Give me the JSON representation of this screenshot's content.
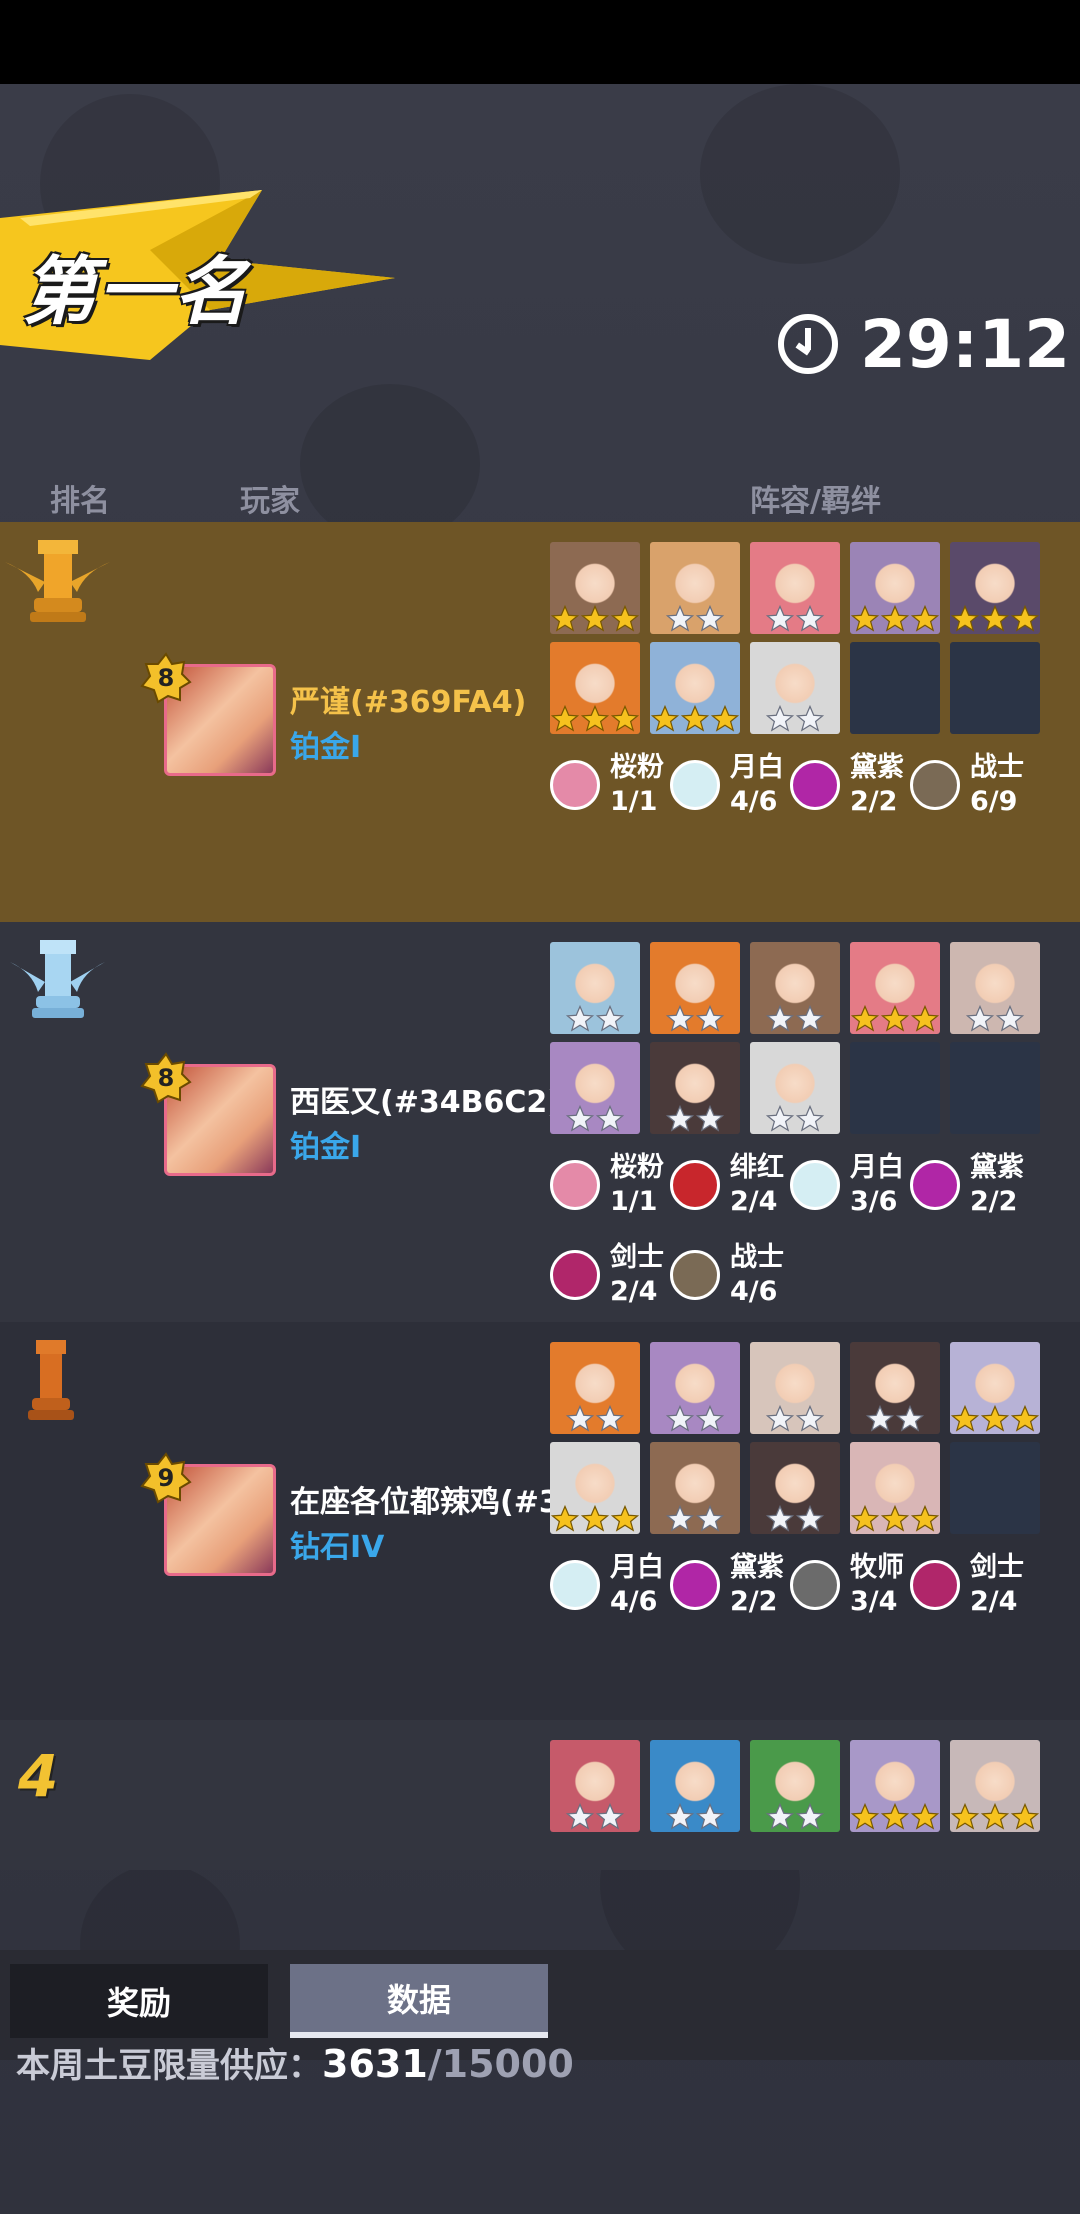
{
  "banner": {
    "title": "第一名",
    "timer": "29:12"
  },
  "columns": {
    "rank": "排名",
    "player": "玩家",
    "lineup": "阵容/羁绊"
  },
  "rows": [
    {
      "rank": 1,
      "player": {
        "level": "8",
        "name": "严谨(#369FA4)",
        "tier": "铂金I",
        "name_color": "#f5c24a"
      },
      "heroes": [
        {
          "stars": 3,
          "color": "#8d6a52"
        },
        {
          "stars": 2,
          "color": "#d9a26b"
        },
        {
          "stars": 2,
          "color": "#e47b86"
        },
        {
          "stars": 3,
          "color": "#9b84b6"
        },
        {
          "stars": 3,
          "color": "#5a4a6a"
        },
        {
          "stars": 3,
          "color": "#e37b2c"
        },
        {
          "stars": 3,
          "color": "#8fb2d8"
        },
        {
          "stars": 2,
          "color": "#d8d8d8"
        },
        {
          "stars": 0,
          "color": ""
        },
        {
          "stars": 0,
          "color": ""
        }
      ],
      "bonds": [
        {
          "name": "桜粉",
          "count": "1/1",
          "icon": "sakura-icon",
          "color": "#e48aa8"
        },
        {
          "name": "月白",
          "count": "4/6",
          "icon": "moon-icon",
          "color": "#d5eef3"
        },
        {
          "name": "黛紫",
          "count": "2/2",
          "icon": "swirl-icon",
          "color": "#b026a6"
        },
        {
          "name": "战士",
          "count": "6/9",
          "icon": "axes-icon",
          "color": "#7a6a55"
        }
      ]
    },
    {
      "rank": 2,
      "player": {
        "level": "8",
        "name": "西医又(#34B6C2)",
        "tier": "铂金I",
        "name_color": "#ffffff"
      },
      "heroes": [
        {
          "stars": 2,
          "color": "#9cc3dc"
        },
        {
          "stars": 2,
          "color": "#e37b2c"
        },
        {
          "stars": 2,
          "color": "#8d6a52"
        },
        {
          "stars": 3,
          "color": "#e47b86"
        },
        {
          "stars": 2,
          "color": "#cdb7b0"
        },
        {
          "stars": 2,
          "color": "#a888c2"
        },
        {
          "stars": 2,
          "color": "#4a3a3a"
        },
        {
          "stars": 2,
          "color": "#d8d8d8"
        },
        {
          "stars": 0,
          "color": ""
        },
        {
          "stars": 0,
          "color": ""
        }
      ],
      "bonds": [
        {
          "name": "桜粉",
          "count": "1/1",
          "icon": "sakura-icon",
          "color": "#e48aa8"
        },
        {
          "name": "绯红",
          "count": "2/4",
          "icon": "rose-icon",
          "color": "#c8262c"
        },
        {
          "name": "月白",
          "count": "3/6",
          "icon": "moon-icon",
          "color": "#d5eef3"
        },
        {
          "name": "黛紫",
          "count": "2/2",
          "icon": "swirl-icon",
          "color": "#b026a6"
        },
        {
          "name": "剑士",
          "count": "2/4",
          "icon": "sword-icon",
          "color": "#b0266a"
        },
        {
          "name": "战士",
          "count": "4/6",
          "icon": "axes-icon",
          "color": "#7a6a55"
        }
      ]
    },
    {
      "rank": 3,
      "player": {
        "level": "9",
        "name": "在座各位都辣鸡(#3",
        "tier": "钻石IV",
        "name_color": "#ffffff"
      },
      "heroes": [
        {
          "stars": 2,
          "color": "#e37b2c"
        },
        {
          "stars": 2,
          "color": "#a888c2"
        },
        {
          "stars": 2,
          "color": "#d7c5bb"
        },
        {
          "stars": 2,
          "color": "#4a3a3a"
        },
        {
          "stars": 3,
          "color": "#b7b2d6"
        },
        {
          "stars": 3,
          "color": "#d8d8d8"
        },
        {
          "stars": 2,
          "color": "#8d6a52"
        },
        {
          "stars": 2,
          "color": "#4a3a3a"
        },
        {
          "stars": 3,
          "color": "#d9b6b6"
        },
        {
          "stars": 0,
          "color": ""
        }
      ],
      "bonds": [
        {
          "name": "月白",
          "count": "4/6",
          "icon": "moon-icon",
          "color": "#d5eef3"
        },
        {
          "name": "黛紫",
          "count": "2/2",
          "icon": "swirl-icon",
          "color": "#b026a6"
        },
        {
          "name": "牧师",
          "count": "3/4",
          "icon": "cross-icon",
          "color": "#6b6b6b"
        },
        {
          "name": "剑士",
          "count": "2/4",
          "icon": "sword-icon",
          "color": "#b0266a"
        }
      ]
    },
    {
      "rank": "4",
      "heroes": [
        {
          "stars": 2,
          "color": "#c65a6a"
        },
        {
          "stars": 2,
          "color": "#3a8ac8"
        },
        {
          "stars": 2,
          "color": "#4a9a4a"
        },
        {
          "stars": 3,
          "color": "#a898c8"
        },
        {
          "stars": 3,
          "color": "#c7b8b8"
        }
      ]
    }
  ],
  "tabs": {
    "rewards": "奖励",
    "data": "数据"
  },
  "supply": {
    "label": "本周土豆限量供应：",
    "value": "3631",
    "cap": "/15000"
  }
}
